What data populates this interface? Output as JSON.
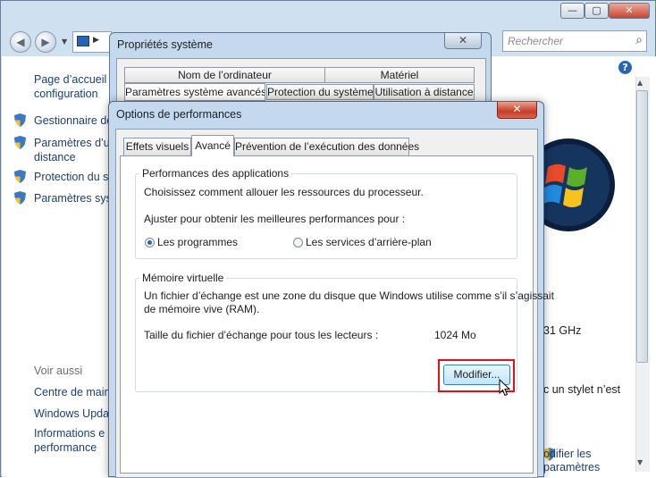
{
  "explorer": {
    "search_placeholder": "Rechercher",
    "left_pane": {
      "home_line1": "Page d’accueil d",
      "home_line2": "configuration",
      "items": [
        {
          "label": "Gestionnaire de"
        },
        {
          "label": "Paramètres d’ut",
          "label2": "distance"
        },
        {
          "label": "Protection du sy"
        },
        {
          "label": "Paramètres syste"
        }
      ],
      "see_also": "Voir aussi",
      "see_also_items": [
        {
          "label": "Centre de maint"
        },
        {
          "label": "Windows Updat"
        },
        {
          "label": "Informations e",
          "label2": "performance"
        }
      ]
    },
    "right_pane": {
      "cpu_frag": "31 GHz",
      "pen_frag": "c un stylet n’est",
      "link_line1": "odifier les",
      "link_line2": "paramètres"
    }
  },
  "system_properties": {
    "title": "Propriétés système",
    "tabs_row1": [
      "Nom de l’ordinateur",
      "Matériel"
    ],
    "tabs_row2": [
      "Paramètres système avancés",
      "Protection du système",
      "Utilisation à distance"
    ]
  },
  "performance_options": {
    "title": "Options de performances",
    "tabs": [
      "Effets visuels",
      "Avancé",
      "Prévention de l’exécution des données"
    ],
    "active_tab": "Avancé",
    "app_perf": {
      "legend": "Performances des applications",
      "description": "Choisissez comment allouer les ressources du processeur.",
      "adjust_label": "Ajuster pour obtenir les meilleures performances pour :",
      "options": [
        "Les programmes",
        "Les services d’arrière-plan"
      ],
      "selected": "Les programmes"
    },
    "virtual_memory": {
      "legend": "Mémoire virtuelle",
      "description_line1": "Un fichier d’échange est une zone du disque que Windows utilise comme s’il s’agissait",
      "description_line2": "de mémoire vive (RAM).",
      "size_label": "Taille du fichier d’échange pour tous les lecteurs :",
      "size_value": "1024 Mo",
      "modify_button": "Modifier..."
    }
  },
  "colors": {
    "highlight": "#e0101a",
    "title_bar": "#c4d8ee",
    "link": "#1e3f6e"
  }
}
